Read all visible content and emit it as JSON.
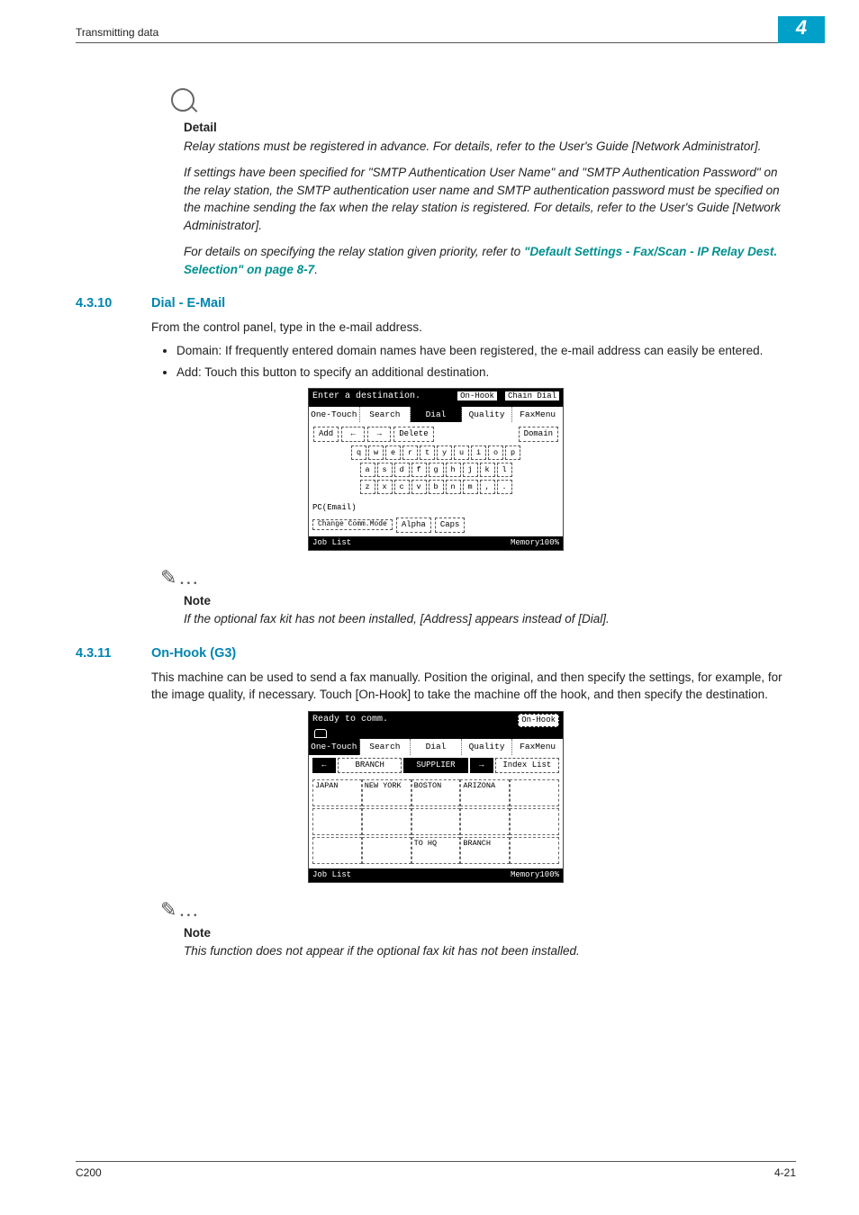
{
  "header": {
    "left": "Transmitting data",
    "chapter": "4"
  },
  "detail": {
    "heading": "Detail",
    "p1": "Relay stations must be registered in advance. For details, refer to the User's Guide [Network Administrator].",
    "p2": "If settings have been specified for \"SMTP Authentication User Name\" and \"SMTP Authentication Password\" on the relay station, the SMTP authentication user name and SMTP authentication password must be specified on the machine sending the fax when the relay station is registered. For details, refer to the User's Guide [Network Administrator].",
    "p3_pre": "For details on specifying the relay station given priority, refer to ",
    "p3_link": "\"Default Settings - Fax/Scan - IP Relay Dest. Selection\" on page 8-7",
    "p3_post": "."
  },
  "sec1": {
    "num": "4.3.10",
    "title": "Dial - E-Mail",
    "p1": "From the control panel, type in the e-mail address.",
    "b1": "Domain: If frequently entered domain names have been registered, the e-mail address can easily be entered.",
    "b2": "Add: Touch this button to specify an additional destination."
  },
  "fig1": {
    "prompt": "Enter a destination.",
    "onhook": "On-Hook",
    "chain": "Chain Dial",
    "tabs": {
      "one": "One-Touch",
      "search": "Search",
      "dial": "Dial",
      "quality": "Quality",
      "faxmenu": "FaxMenu"
    },
    "add": "Add",
    "left": "←",
    "right": "→",
    "delete": "Delete",
    "domain": "Domain",
    "row1": [
      "q",
      "w",
      "e",
      "r",
      "t",
      "y",
      "u",
      "i",
      "o",
      "p"
    ],
    "row2": [
      "a",
      "s",
      "d",
      "f",
      "g",
      "h",
      "j",
      "k",
      "l"
    ],
    "row3": [
      "z",
      "x",
      "c",
      "v",
      "b",
      "n",
      "m",
      ",",
      "."
    ],
    "mode_label": "PC(Email)",
    "change": "Change Comm.Mode",
    "alpha": "Alpha",
    "caps": "Caps",
    "joblist": "Job List",
    "memory": "Memory100%"
  },
  "note1": {
    "heading": "Note",
    "text": "If the optional fax kit has not been installed, [Address] appears instead of [Dial]."
  },
  "sec2": {
    "num": "4.3.11",
    "title": "On-Hook (G3)",
    "p1": "This machine can be used to send a fax manually. Position the original, and then specify the settings, for example, for the image quality, if necessary. Touch [On-Hook] to take the machine off the hook, and then specify the destination."
  },
  "fig2": {
    "prompt": "Ready to comm.",
    "onhook": "On-Hook",
    "tabs": {
      "one": "One-Touch",
      "search": "Search",
      "dial": "Dial",
      "quality": "Quality",
      "faxmenu": "FaxMenu"
    },
    "nav": {
      "left": "←",
      "branch": "BRANCH",
      "supplier": "SUPPLIER",
      "right": "→",
      "index": "Index List"
    },
    "cells_r1": [
      "JAPAN",
      "NEW YORK",
      "BOSTON",
      "ARIZONA",
      ""
    ],
    "cells_r2": [
      "",
      "",
      "",
      "",
      ""
    ],
    "cells_r3": [
      "",
      "",
      "TO HQ",
      "BRANCH",
      ""
    ],
    "joblist": "Job List",
    "memory": "Memory100%"
  },
  "note2": {
    "heading": "Note",
    "text": "This function does not appear if the optional fax kit has not been installed."
  },
  "footer": {
    "left": "C200",
    "right": "4-21"
  }
}
